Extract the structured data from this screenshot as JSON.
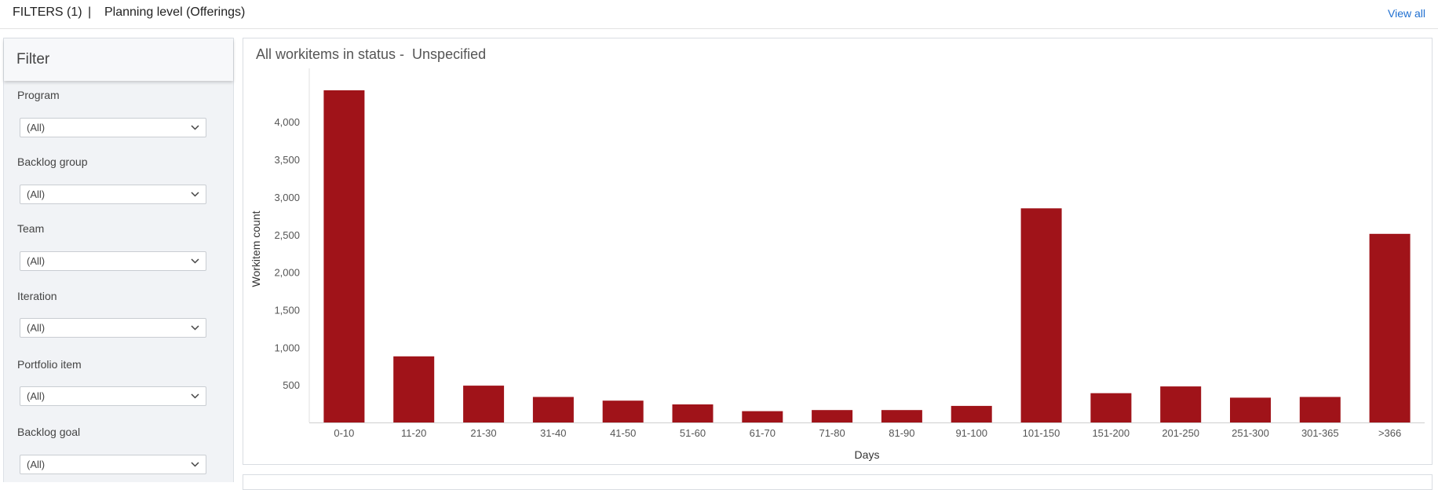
{
  "topbar": {
    "filters_label": "FILTERS (1)",
    "separator": "|",
    "planning_level": "Planning level  (Offerings)",
    "view_all": "View all"
  },
  "filter_panel": {
    "title": "Filter",
    "filters": [
      {
        "label": "Program",
        "value": "(All)"
      },
      {
        "label": "Backlog group",
        "value": "(All)"
      },
      {
        "label": "Team",
        "value": "(All)"
      },
      {
        "label": "Iteration",
        "value": "(All)"
      },
      {
        "label": "Portfolio item",
        "value": "(All)"
      },
      {
        "label": "Backlog goal",
        "value": "(All)"
      }
    ]
  },
  "chart_panel": {
    "title": "All workitems in status -",
    "status": "Unspecified"
  },
  "colors": {
    "bar": "#a01319",
    "link": "#1f6fd0"
  },
  "chart_data": {
    "type": "bar",
    "categories": [
      "0-10",
      "11-20",
      "21-30",
      "31-40",
      "41-50",
      "51-60",
      "61-70",
      "71-80",
      "81-90",
      "91-100",
      "101-150",
      "151-200",
      "201-250",
      "251-300",
      "301-365",
      ">366"
    ],
    "values": [
      4420,
      880,
      490,
      340,
      290,
      240,
      150,
      165,
      165,
      220,
      2850,
      390,
      480,
      330,
      340,
      2510
    ],
    "xlabel": "Days",
    "ylabel": "Workitem count",
    "yticks": [
      500,
      1000,
      1500,
      2000,
      2500,
      3000,
      3500,
      4000
    ],
    "ytick_labels": [
      "500",
      "1,000",
      "1,500",
      "2,000",
      "2,500",
      "3,000",
      "3,500",
      "4,000"
    ],
    "ylim": [
      0,
      4650
    ],
    "grid": false
  }
}
